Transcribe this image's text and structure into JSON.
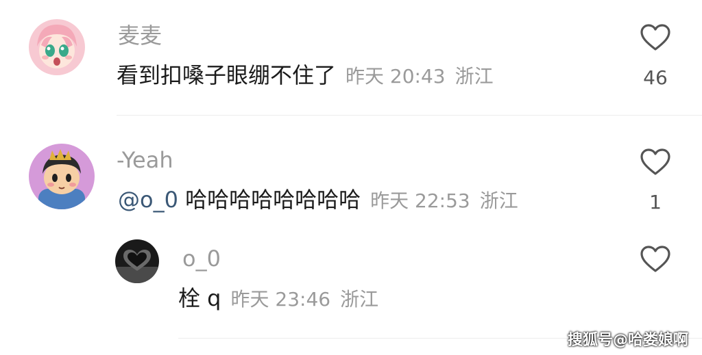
{
  "comments": [
    {
      "username": "麦麦",
      "text": "看到扣嗓子眼绷不住了",
      "time": "昨天 20:43",
      "location": "浙江",
      "likes": "46",
      "avatar_icon": "anime-girl-pink-hair-avatar"
    },
    {
      "username": "-Yeah",
      "mention": "@o_0",
      "text": "哈哈哈哈哈哈哈哈",
      "time": "昨天 22:53",
      "location": "浙江",
      "likes": "1",
      "avatar_icon": "cartoon-boy-avatar"
    }
  ],
  "reply": {
    "username": "o_0",
    "text": "栓 q",
    "time": "昨天 23:46",
    "location": "浙江",
    "avatar_icon": "dark-heart-hands-avatar"
  },
  "watermark": "搜狐号@哈娄娘啊",
  "colors": {
    "username": "#9a9a9a",
    "text": "#1b1b1b",
    "mention": "#3b5876",
    "meta": "#9a9a9a"
  }
}
